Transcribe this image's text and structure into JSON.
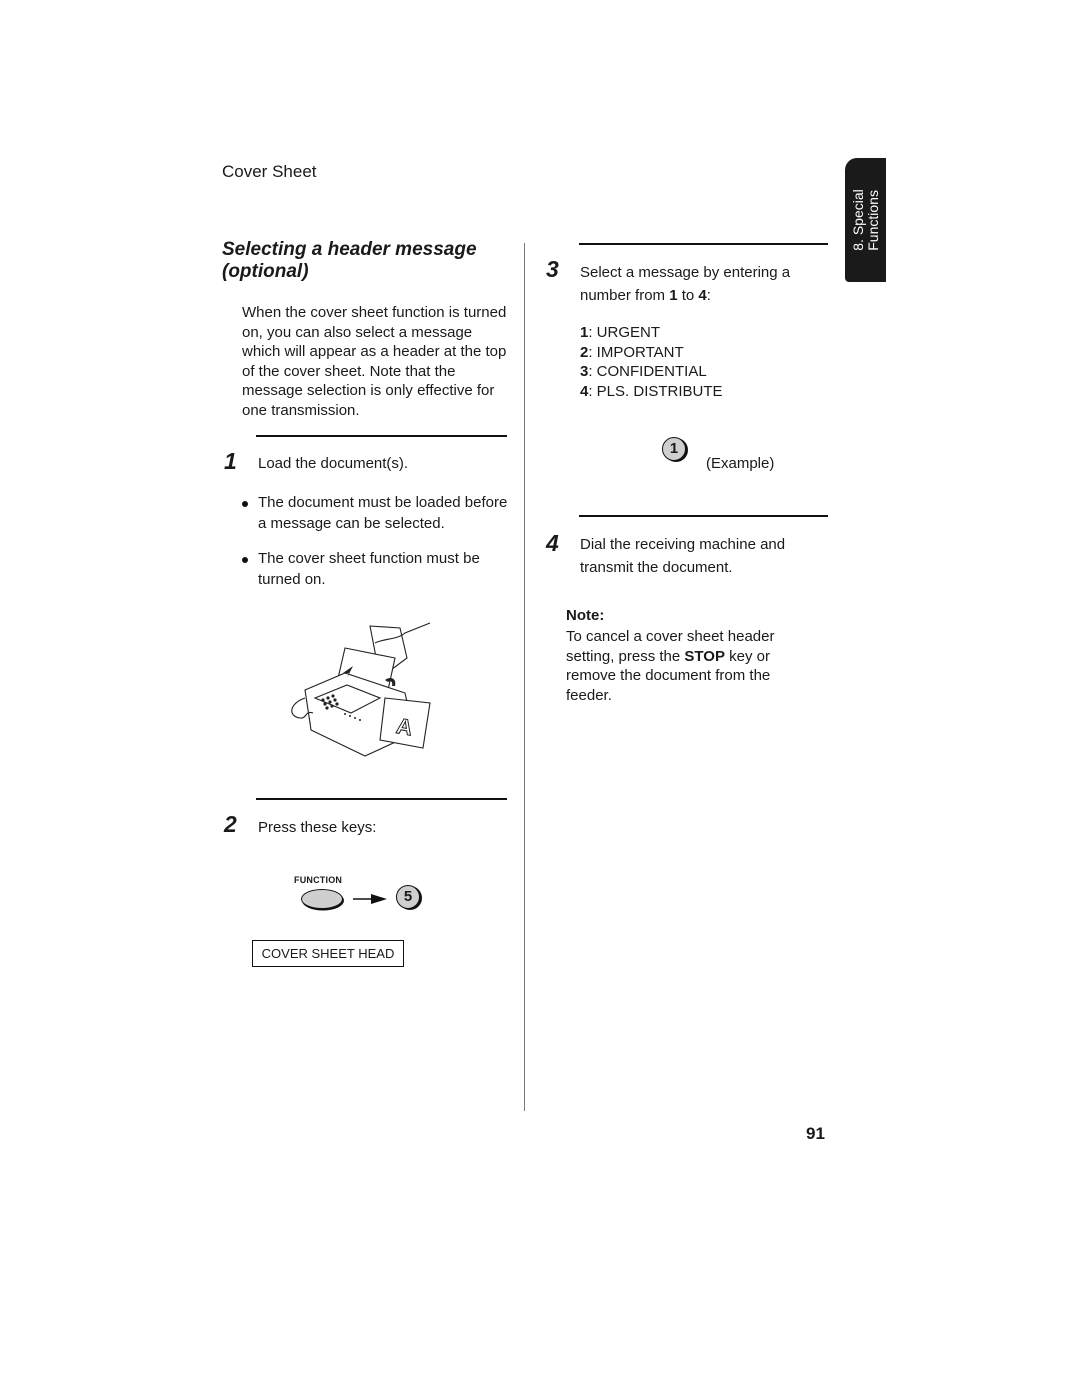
{
  "section_title": "Cover Sheet",
  "heading": "Selecting a header message (optional)",
  "intro": "When the cover sheet function is turned on, you can also select a message which will appear as a header at the top of the cover sheet. Note that the message selection is only effective for one transmission.",
  "side_tab": {
    "line1": "8. Special",
    "line2": "Functions"
  },
  "steps": [
    {
      "number": "1",
      "text": "Load the document(s).",
      "bullets": [
        "The document must be loaded before a message can be selected.",
        "The cover sheet function must be turned on."
      ],
      "illustration": "fax-machine-loading-document-illustration"
    },
    {
      "number": "2",
      "text": "Press these keys:",
      "keys": {
        "function_label": "FUNCTION",
        "number_key": "5"
      },
      "display": "COVER SHEET HEAD"
    },
    {
      "number": "3",
      "text_pre": "Select a message by entering a number from ",
      "text_from": "1",
      "text_mid": " to ",
      "text_to": "4",
      "text_post": ":",
      "options": [
        {
          "num": "1",
          "label": ": URGENT"
        },
        {
          "num": "2",
          "label": ": IMPORTANT"
        },
        {
          "num": "3",
          "label": ": CONFIDENTIAL"
        },
        {
          "num": "4",
          "label": ": PLS. DISTRIBUTE"
        }
      ],
      "example_key": "1",
      "example_label": "(Example)"
    },
    {
      "number": "4",
      "text": "Dial the receiving machine and transmit the document."
    }
  ],
  "note": {
    "label": "Note:",
    "text_pre": "To cancel a cover sheet header setting, press the ",
    "text_bold": "STOP",
    "text_post": " key or remove the document from the feeder."
  },
  "page_number": "91"
}
